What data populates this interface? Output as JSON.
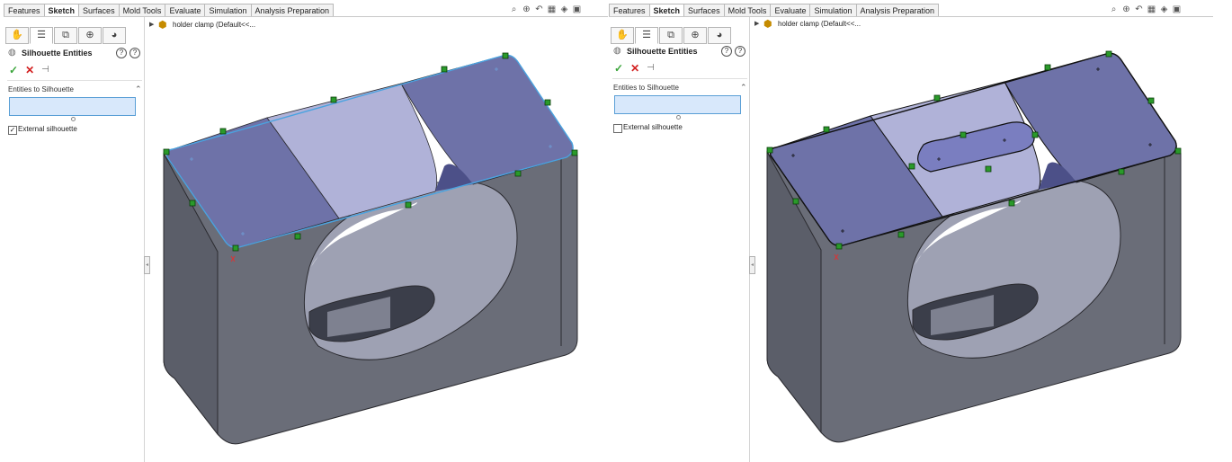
{
  "tabs": [
    "Features",
    "Sketch",
    "Surfaces",
    "Mold Tools",
    "Evaluate",
    "Simulation",
    "Analysis Preparation"
  ],
  "active_tab": "Sketch",
  "panel": {
    "title": "Silhouette Entities",
    "section_title": "Entities to Silhouette",
    "external_silhouette_label": "External silhouette",
    "help_glyph": "?",
    "ok_glyph": "✓",
    "cancel_glyph": "✕",
    "pin_glyph": "⊣"
  },
  "tree_item": "holder clamp  (Default<<...",
  "screens": [
    {
      "external_silhouette_checked": true,
      "check_glyph": "✓"
    },
    {
      "external_silhouette_checked": false,
      "check_glyph": ""
    }
  ],
  "icons": {
    "panel_tabs": [
      "feature-manager-icon",
      "property-manager-icon",
      "configuration-manager-icon",
      "dimxpert-icon",
      "display-manager-icon"
    ],
    "view_tools": [
      "zoom-fit-icon",
      "zoom-area-icon",
      "previous-view-icon",
      "section-view-icon",
      "view-orientation-icon",
      "display-style-icon"
    ]
  },
  "colors": {
    "arrow": "#e8403a",
    "face_dark": "#6e72a8",
    "face_light": "#b0b2d8",
    "body": "#6a6d78",
    "selection_blue": "#4aa3e0",
    "point_green": "#2a9a2a"
  }
}
